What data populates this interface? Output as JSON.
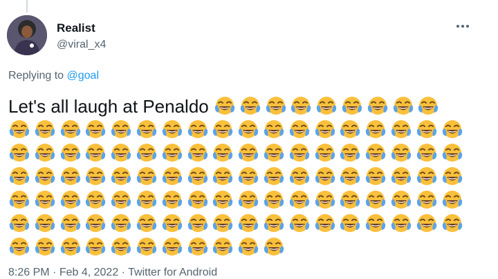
{
  "author": {
    "display_name": "Realist",
    "handle": "@viral_x4"
  },
  "reply": {
    "prefix": "Replying to ",
    "mention": "@goal"
  },
  "tweet": {
    "text": "Let's all laugh at Penaldo ",
    "emoji": "face-with-tears-of-joy",
    "emoji_rows": [
      9,
      18,
      18,
      18,
      18,
      18,
      11
    ]
  },
  "meta": {
    "time": "8:26 PM",
    "date": "Feb 4, 2022",
    "separator": " · ",
    "source": "Twitter for Android"
  },
  "colors": {
    "link": "#1d9bf0",
    "secondary_text": "#536471",
    "emoji_face": "#f9c03c",
    "emoji_tears": "#5ea3e6"
  }
}
